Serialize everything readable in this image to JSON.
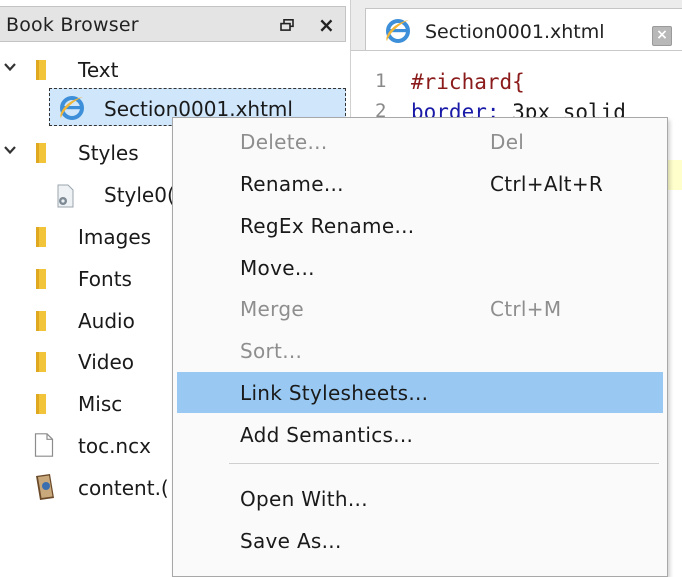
{
  "book_browser": {
    "title": "Book Browser",
    "float_icon": "float-window-icon",
    "close_label": "×",
    "items": [
      {
        "label": "Text",
        "icon": "folder-icon",
        "expanded": true
      },
      {
        "label": "Section0001.xhtml",
        "icon": "internet-explorer-icon",
        "selected": true
      },
      {
        "label": "Styles",
        "icon": "folder-icon",
        "expanded": true
      },
      {
        "label": "Style0(",
        "icon": "stylesheet-file-icon"
      },
      {
        "label": "Images",
        "icon": "folder-icon"
      },
      {
        "label": "Fonts",
        "icon": "folder-icon"
      },
      {
        "label": "Audio",
        "icon": "folder-icon"
      },
      {
        "label": "Video",
        "icon": "folder-icon"
      },
      {
        "label": "Misc",
        "icon": "folder-icon"
      },
      {
        "label": "toc.ncx",
        "icon": "blank-document-icon"
      },
      {
        "label": "content.(",
        "icon": "book-opf-icon"
      }
    ]
  },
  "editor": {
    "tab_label": "Section0001.xhtml",
    "tab_close_label": "×",
    "lines": [
      {
        "num": "1",
        "text": "#richard{"
      },
      {
        "num": "2",
        "prop": "border:",
        "value": " 3px solid"
      }
    ]
  },
  "context_menu": {
    "items": [
      {
        "label": "Delete...",
        "shortcut": "Del",
        "enabled": false
      },
      {
        "label": "Rename...",
        "shortcut": "Ctrl+Alt+R",
        "enabled": true
      },
      {
        "label": "RegEx Rename...",
        "shortcut": "",
        "enabled": true
      },
      {
        "label": "Move...",
        "shortcut": "",
        "enabled": true
      },
      {
        "label": "Merge",
        "shortcut": "Ctrl+M",
        "enabled": false
      },
      {
        "label": "Sort...",
        "shortcut": "",
        "enabled": false
      },
      {
        "label": "Link Stylesheets...",
        "shortcut": "",
        "enabled": true,
        "highlighted": true
      },
      {
        "label": "Add Semantics...",
        "shortcut": "",
        "enabled": true
      },
      {
        "label": "Open With...",
        "shortcut": "",
        "enabled": true
      },
      {
        "label": "Save As...",
        "shortcut": "",
        "enabled": true
      }
    ]
  },
  "colors": {
    "highlight": "#99c9f2",
    "selection": "#cfe6fb",
    "folder": "#f2c43a",
    "disabled_text": "#8e8e8e"
  }
}
